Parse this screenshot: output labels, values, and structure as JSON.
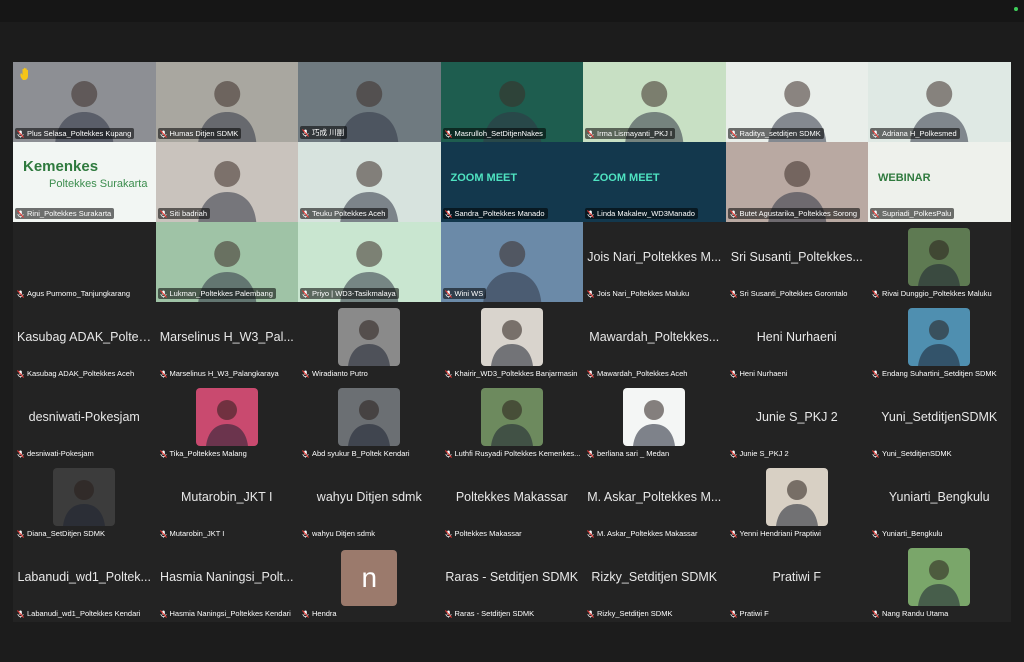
{
  "meeting": {
    "tiles": [
      {
        "name": "Plus Selasa_Poltekkes Kupang",
        "type": "video",
        "bg": "#8d8f94",
        "raised_hand": true
      },
      {
        "name": "Humas Ditjen SDMK",
        "type": "video",
        "bg": "#a9a7a0",
        "highlight": true,
        "pin": true
      },
      {
        "name": "巧成 川副",
        "type": "video",
        "bg": "#6f7a80"
      },
      {
        "name": "Masrulloh_SetDitjenNakes",
        "type": "video",
        "bg": "#1e5d4f"
      },
      {
        "name": "Irma Lismayanti_PKJ I",
        "type": "video",
        "bg": "#c8e0c4"
      },
      {
        "name": "Raditya_setditjen SDMK",
        "type": "video",
        "bg": "#e9eeea"
      },
      {
        "name": "Adriana H_Polkesmed",
        "type": "video",
        "bg": "#dfe9e4"
      },
      {
        "name": "Rini_Poltekkes Surakarta",
        "type": "slide",
        "bg": "#f2f6f3",
        "slide_title": "Kemenkes",
        "slide_sub": "Poltekkes Surakarta"
      },
      {
        "name": "Siti badriah",
        "type": "video",
        "bg": "#c9c3bd"
      },
      {
        "name": "Teuku Poltekkes Aceh",
        "type": "video",
        "bg": "#d7e3de"
      },
      {
        "name": "Sandra_Poltekkes Manado",
        "type": "slide",
        "bg": "#13384d",
        "slide_title": "ZOOM MEET"
      },
      {
        "name": "Linda Makalew_WD3Manado",
        "type": "slide",
        "bg": "#13384d",
        "slide_title": "ZOOM MEET"
      },
      {
        "name": "Butet Agustarika_Poltekkes Sorong",
        "type": "video",
        "bg": "#b9a9a2"
      },
      {
        "name": "Supriadi_PolkesPalu",
        "type": "slide",
        "bg": "#eef1ec",
        "slide_title": "WEBINAR"
      },
      {
        "name": "Agus Purnomo_Tanjungkarang",
        "type": "name",
        "display": ""
      },
      {
        "name": "Lukman_Poltekkes Palembang",
        "type": "video",
        "bg": "#9fc3a6"
      },
      {
        "name": "Priyo | WD3-Tasikmalaya",
        "type": "video",
        "bg": "#c9e6d0"
      },
      {
        "name": "Wini WS",
        "type": "video",
        "bg": "#6b8aa8"
      },
      {
        "name": "Jois Nari_Poltekkes Maluku",
        "type": "name",
        "display": "Jois Nari_Poltekkes M..."
      },
      {
        "name": "Sri Susanti_Poltekkes Gorontalo",
        "type": "name",
        "display": "Sri Susanti_Poltekkes..."
      },
      {
        "name": "Rivai Dunggio_Poltekkes Maluku",
        "type": "thumb",
        "bg": "#5e7a52"
      },
      {
        "name": "Kasubag ADAK_Poltekkes Aceh",
        "type": "name",
        "display": "Kasubag ADAK_Poltek..."
      },
      {
        "name": "Marselinus H_W3_Palangkaraya",
        "type": "name",
        "display": "Marselinus H_W3_Pal..."
      },
      {
        "name": "Wiradianto Putro",
        "type": "thumb",
        "bg": "#8a8a8a"
      },
      {
        "name": "Khairir_WD3_Poltekkes Banjarmasin",
        "type": "thumb",
        "bg": "#d9d4cd"
      },
      {
        "name": "Mawardah_Poltekkes Aceh",
        "type": "name",
        "display": "Mawardah_Poltekkes..."
      },
      {
        "name": "Heni Nurhaeni",
        "type": "name",
        "display": "Heni Nurhaeni"
      },
      {
        "name": "Endang Suhartini_Setditjen SDMK",
        "type": "thumb",
        "bg": "#4f8fb0"
      },
      {
        "name": "desniwati-Pokesjam",
        "type": "name",
        "display": "desniwati-Pokesjam"
      },
      {
        "name": "Tika_Poltekkes Malang",
        "type": "thumb",
        "bg": "#c94a6f"
      },
      {
        "name": "Abd syukur B_Poltek Kendari",
        "type": "thumb",
        "bg": "#6b6f73"
      },
      {
        "name": "Luthfi Rusyadi Poltekkes Kemenkes...",
        "type": "thumb",
        "bg": "#6d8a5e"
      },
      {
        "name": "berliana sari _ Medan",
        "type": "thumb",
        "bg": "#f4f6f5"
      },
      {
        "name": "Junie S_PKJ 2",
        "type": "name",
        "display": "Junie S_PKJ 2"
      },
      {
        "name": "Yuni_SetditjenSDMK",
        "type": "name",
        "display": "Yuni_SetditjenSDMK"
      },
      {
        "name": "Diana_SetDitjen SDMK",
        "type": "thumb",
        "bg": "#3c3c3c"
      },
      {
        "name": "Mutarobin_JKT I",
        "type": "name",
        "display": "Mutarobin_JKT I"
      },
      {
        "name": "wahyu Ditjen sdmk",
        "type": "name",
        "display": "wahyu Ditjen sdmk"
      },
      {
        "name": "Poltekkes Makassar",
        "type": "name",
        "display": "Poltekkes Makassar"
      },
      {
        "name": "M. Askar_Poltekkes Makassar",
        "type": "name",
        "display": "M. Askar_Poltekkes M..."
      },
      {
        "name": "Yenni Hendriani Praptiwi",
        "type": "thumb",
        "bg": "#d8d0c4"
      },
      {
        "name": "Yuniarti_Bengkulu",
        "type": "name",
        "display": "Yuniarti_Bengkulu"
      },
      {
        "name": "Labanudi_wd1_Poltekkes Kendari",
        "type": "name",
        "display": "Labanudi_wd1_Poltek..."
      },
      {
        "name": "Hasmia Naningsi_Poltekkes Kendari",
        "type": "name",
        "display": "Hasmia Naningsi_Polt..."
      },
      {
        "name": "Hendra",
        "type": "letter",
        "letter": "n"
      },
      {
        "name": "Raras - Setditjen SDMK",
        "type": "name",
        "display": "Raras - Setditjen SDMK"
      },
      {
        "name": "Rizky_Setditjen SDMK",
        "type": "name",
        "display": "Rizky_Setditjen SDMK"
      },
      {
        "name": "Pratiwi F",
        "type": "name",
        "display": "Pratiwi F"
      },
      {
        "name": "Nang Randu Utama",
        "type": "thumb",
        "bg": "#7aa66a"
      }
    ]
  }
}
